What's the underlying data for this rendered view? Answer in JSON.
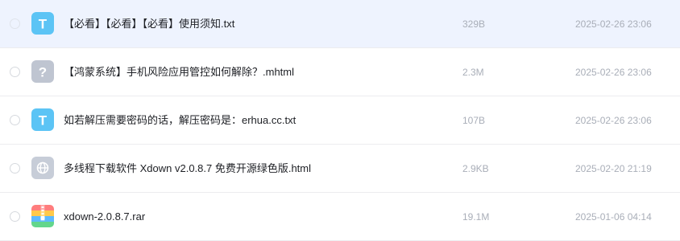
{
  "files": [
    {
      "name": "【必看】【必看】【必看】使用须知.txt",
      "size": "329B",
      "date": "2025-02-26 23:06",
      "icon": "txt-file-icon",
      "hovered": true
    },
    {
      "name": "【鸿蒙系统】手机风险应用管控如何解除？.mhtml",
      "size": "2.3M",
      "date": "2025-02-26 23:06",
      "icon": "unknown-file-icon",
      "hovered": false
    },
    {
      "name": "如若解压需要密码的话，解压密码是：erhua.cc.txt",
      "size": "107B",
      "date": "2025-02-26 23:06",
      "icon": "txt-file-icon",
      "hovered": false
    },
    {
      "name": "多线程下载软件 Xdown v2.0.8.7 免费开源绿色版.html",
      "size": "2.9KB",
      "date": "2025-02-20 21:19",
      "icon": "html-file-icon",
      "hovered": false
    },
    {
      "name": "xdown-2.0.8.7.rar",
      "size": "19.1M",
      "date": "2025-01-06 04:14",
      "icon": "archive-file-icon",
      "hovered": false
    }
  ],
  "icon_glyphs": {
    "txt": "T",
    "unknown": "?"
  },
  "colors": {
    "hover_bg": "#eef3fe",
    "txt_icon": "#5cc4f5",
    "muted_text": "#a9aeb8",
    "divider": "#ececef"
  }
}
